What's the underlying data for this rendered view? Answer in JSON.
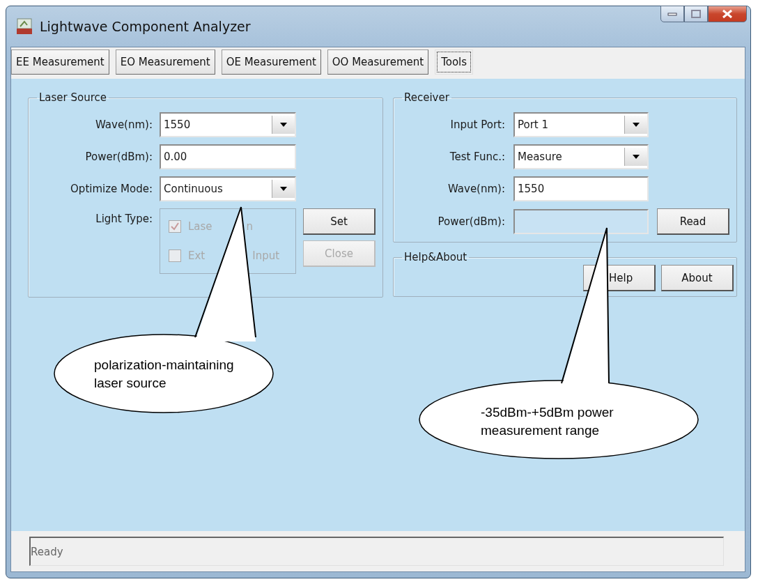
{
  "window": {
    "title": "Lightwave Component Analyzer"
  },
  "tabs": [
    {
      "label": "EE Measurement",
      "selected": false
    },
    {
      "label": "EO Measurement",
      "selected": false
    },
    {
      "label": "OE Measurement",
      "selected": false
    },
    {
      "label": "OO Measurement",
      "selected": false
    },
    {
      "label": "Tools",
      "selected": true
    }
  ],
  "laser_source": {
    "title": "Laser Source",
    "fields": [
      {
        "kind": "combo",
        "label": "Wave(nm):",
        "value": "1550"
      },
      {
        "kind": "text",
        "label": "Power(dBm):",
        "value": "0.00"
      },
      {
        "kind": "combo",
        "label": "Optimize Mode:",
        "value": "Continuous"
      }
    ],
    "light_type": {
      "label": "Light Type:",
      "options": [
        {
          "label_parts": [
            "Lase",
            "n"
          ],
          "checked": true,
          "disabled": true
        },
        {
          "label_parts": [
            "Ext",
            "Input"
          ],
          "checked": false,
          "disabled": true
        }
      ]
    },
    "buttons": [
      {
        "label": "Set",
        "disabled": false
      },
      {
        "label": "Close",
        "disabled": true
      }
    ]
  },
  "receiver": {
    "title": "Receiver",
    "fields": [
      {
        "kind": "combo",
        "label": "Input Port:",
        "value": "Port 1"
      },
      {
        "kind": "combo",
        "label": "Test Func.:",
        "value": "Measure"
      },
      {
        "kind": "text",
        "label": "Wave(nm):",
        "value": "1550"
      },
      {
        "kind": "readonly",
        "label": "Power(dBm):"
      }
    ],
    "buttons": [
      {
        "label": "Read",
        "disabled": false
      }
    ]
  },
  "help_about": {
    "title": "Help&About",
    "buttons": [
      {
        "label": "Help",
        "disabled": false
      },
      {
        "label": "About",
        "disabled": false
      }
    ]
  },
  "callouts": [
    {
      "lines": [
        "polarization-maintaining",
        "laser source"
      ]
    },
    {
      "lines": [
        "-35dBm-+5dBm power",
        "measurement range"
      ]
    }
  ],
  "status_bar": {
    "text": "Ready"
  }
}
